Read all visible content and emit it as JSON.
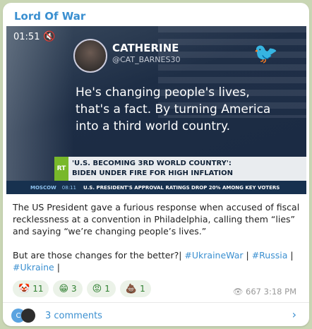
{
  "channel": {
    "name": "Lord Of War"
  },
  "video": {
    "duration": "01:51",
    "author": "CATHERINE",
    "handle": "@CAT_BARNES30",
    "quote": "He's changing people's lives, that's a fact. By turning America into a third world country.",
    "logo_text": "RT",
    "ticker_line1": "'U.S. BECOMING 3RD WORLD COUNTRY':",
    "ticker_line2": "BIDEN UNDER FIRE FOR HIGH INFLATION",
    "location": "MOSCOW",
    "clock": "08:11",
    "ticker_bottom": "U.S. PRESIDENT'S APPROVAL RATINGS DROP 20% AMONG KEY VOTERS"
  },
  "post": {
    "paragraph1": "The US President gave a furious response when accused of fiscal recklessness at a convention in Philadelphia, calling them “lies” and saying “we’re changing people’s lives.”",
    "paragraph2_start": "But are those changes for the better?| ",
    "hashtags": [
      "#UkraineWar",
      "#Russia",
      "#Ukraine"
    ],
    "sep": " | ",
    "end": " |"
  },
  "reactions": [
    {
      "icon": "clown-face-icon",
      "glyph": "🤡",
      "count": "11"
    },
    {
      "icon": "grin-face-icon",
      "glyph": "😁",
      "count": "3"
    },
    {
      "icon": "angry-face-icon",
      "glyph": "😡",
      "count": "1"
    },
    {
      "icon": "poop-icon",
      "glyph": "💩",
      "count": "1"
    }
  ],
  "meta": {
    "views": "667",
    "time": "3:18 PM"
  },
  "comments": {
    "label": "3 comments",
    "avatar_letter": "C"
  },
  "colors": {
    "accent": "#3a8fd0",
    "background": "#c9d6b4"
  }
}
